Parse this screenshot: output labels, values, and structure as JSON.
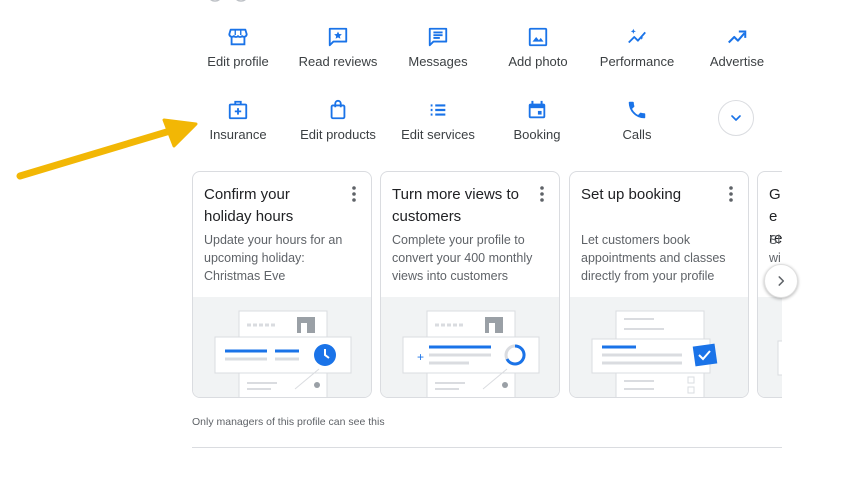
{
  "actions_row1": [
    {
      "label": "Edit profile",
      "icon": "storefront-icon"
    },
    {
      "label": "Read reviews",
      "icon": "star-review-icon"
    },
    {
      "label": "Messages",
      "icon": "message-icon"
    },
    {
      "label": "Add photo",
      "icon": "photo-icon"
    },
    {
      "label": "Performance",
      "icon": "sparkline-icon"
    },
    {
      "label": "Advertise",
      "icon": "trending-up-icon"
    }
  ],
  "actions_row2": [
    {
      "label": "Insurance",
      "icon": "medical-bag-icon"
    },
    {
      "label": "Edit products",
      "icon": "shopping-bag-icon"
    },
    {
      "label": "Edit services",
      "icon": "list-icon"
    },
    {
      "label": "Booking",
      "icon": "calendar-icon"
    },
    {
      "label": "Calls",
      "icon": "phone-icon"
    }
  ],
  "cards": [
    {
      "title": "Confirm your holiday hours",
      "desc": "Update your hours for an upcoming holiday: Christmas Eve"
    },
    {
      "title": "Turn more views to customers",
      "desc": "Complete your profile to convert your 400 monthly views into customers"
    },
    {
      "title": "Set up booking",
      "desc": "Let customers book appointments and classes directly from your profile"
    },
    {
      "title": "Ge re",
      "desc": "Sh wi"
    }
  ],
  "footnote": "Only managers of this profile can see this",
  "colors": {
    "accent": "#1a73e8",
    "arrow": "#f2b705",
    "text": "#3c4043",
    "muted": "#5f6368"
  }
}
